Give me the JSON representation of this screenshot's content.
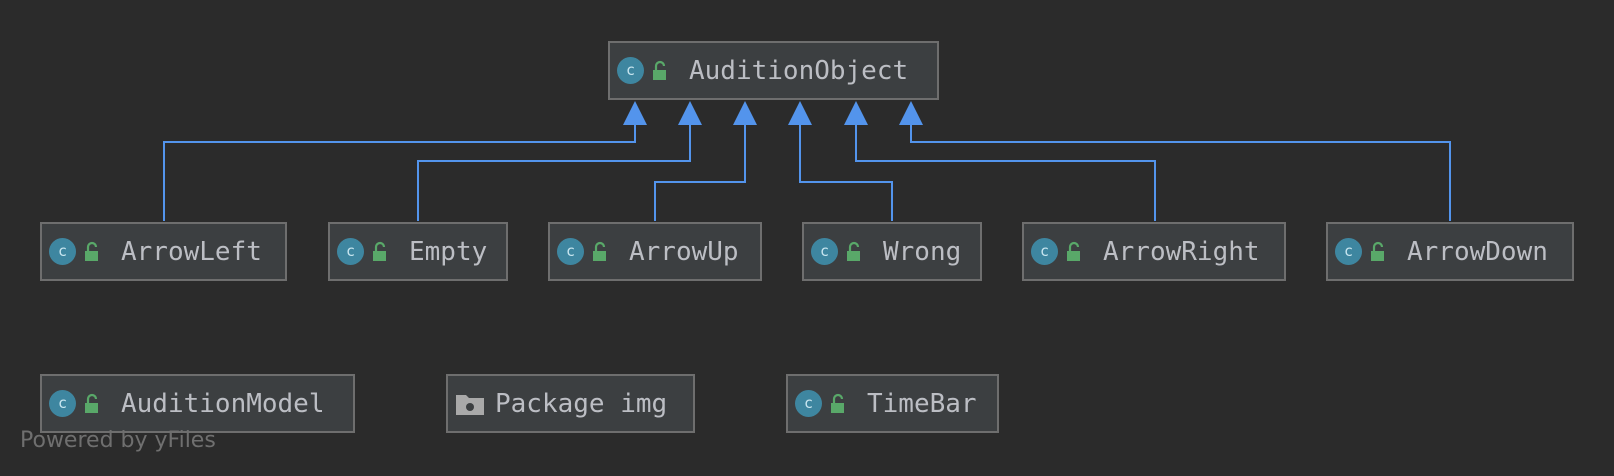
{
  "diagram": {
    "parent": {
      "name": "AuditionObject",
      "kind": "class",
      "visibility": "public"
    },
    "subclasses": [
      {
        "name": "ArrowLeft",
        "kind": "class",
        "visibility": "public"
      },
      {
        "name": "Empty",
        "kind": "class",
        "visibility": "public"
      },
      {
        "name": "ArrowUp",
        "kind": "class",
        "visibility": "public"
      },
      {
        "name": "Wrong",
        "kind": "class",
        "visibility": "public"
      },
      {
        "name": "ArrowRight",
        "kind": "class",
        "visibility": "public"
      },
      {
        "name": "ArrowDown",
        "kind": "class",
        "visibility": "public"
      }
    ],
    "standalone": [
      {
        "name": "AuditionModel",
        "kind": "class",
        "visibility": "public"
      },
      {
        "name": "Package img",
        "kind": "package"
      },
      {
        "name": "TimeBar",
        "kind": "class",
        "visibility": "public"
      }
    ],
    "relation": "inheritance",
    "watermark": "Powered by yFiles",
    "icon_letter": "c",
    "colors": {
      "background": "#2b2b2b",
      "node_fill": "#3c3f41",
      "node_border": "#6e6e6e",
      "edge": "#5394ec",
      "class_icon": "#3e86a0",
      "lock_icon": "#59a869",
      "text": "#bcbec4"
    },
    "icons": {
      "class": "class-icon",
      "visibility": "unlocked-icon",
      "package": "folder-icon"
    }
  }
}
